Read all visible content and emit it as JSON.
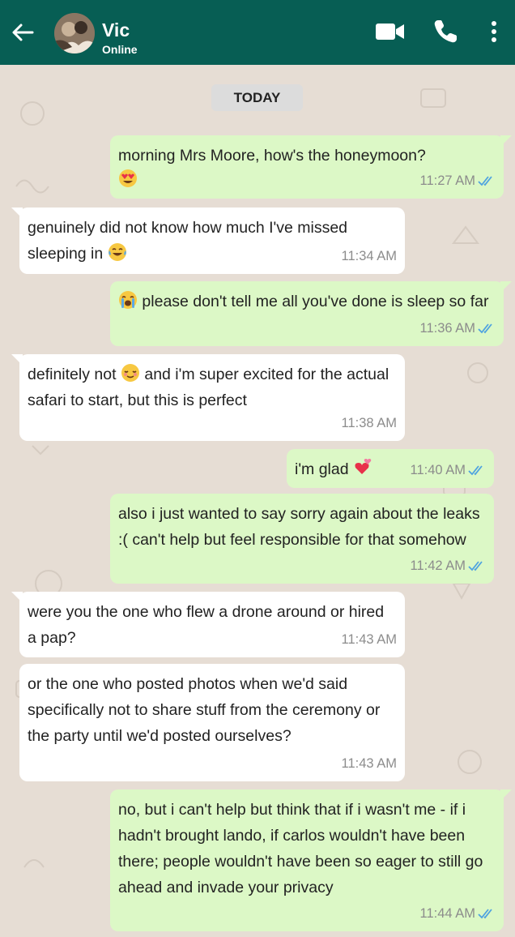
{
  "header": {
    "contact_name": "Vic",
    "contact_status": "Online",
    "bg_color": "#075e54",
    "icons": [
      "back-arrow-icon",
      "video-call-icon",
      "phone-call-icon",
      "more-options-icon"
    ]
  },
  "chat": {
    "date_label": "TODAY",
    "messages": [
      {
        "dir": "out",
        "text": "morning Mrs Moore, how's the honeymoon?",
        "emoji_after_line": "heart-eyes-emoji",
        "time": "11:27 AM",
        "read": true
      },
      {
        "dir": "in",
        "text": "genuinely did not know how much I've missed sleeping in",
        "emoji": "tears-of-joy-emoji",
        "time": "11:34 AM"
      },
      {
        "dir": "out",
        "text_after_emoji": "please don't tell me all you've done is sleep so far",
        "emoji": "crying-emoji",
        "time": "11:36 AM",
        "read": true
      },
      {
        "dir": "in",
        "text_a": "definitely not",
        "emoji": "relieved-emoji",
        "text_b": "and i'm super excited for the actual safari to start, but this is perfect",
        "time": "11:38 AM"
      },
      {
        "dir": "out",
        "text": "i'm glad",
        "emoji": "two-hearts-emoji",
        "time": "11:40 AM",
        "read": true
      },
      {
        "dir": "out",
        "text": "also i just wanted to say sorry again about the leaks :( can't help but feel responsible for that somehow",
        "time": "11:42 AM",
        "read": true
      },
      {
        "dir": "in",
        "text": "were you the one who flew a drone around or hired a pap?",
        "time": "11:43 AM"
      },
      {
        "dir": "in",
        "text": "or the one who posted photos when we'd said specifically not to share stuff from the ceremony or the party until we'd posted ourselves?",
        "time": "11:43 AM"
      },
      {
        "dir": "out",
        "text": "no, but i can't help but think that if i wasn't me - if i hadn't brought lando, if carlos wouldn't have been there; people wouldn't have been so eager to still go ahead and invade your privacy",
        "time": "11:44 AM",
        "read": true
      }
    ]
  },
  "colors": {
    "outgoing_bubble": "#dcf8c6",
    "incoming_bubble": "#ffffff",
    "chat_bg": "#e6ddd4",
    "read_ticks": "#4fa3e0"
  }
}
